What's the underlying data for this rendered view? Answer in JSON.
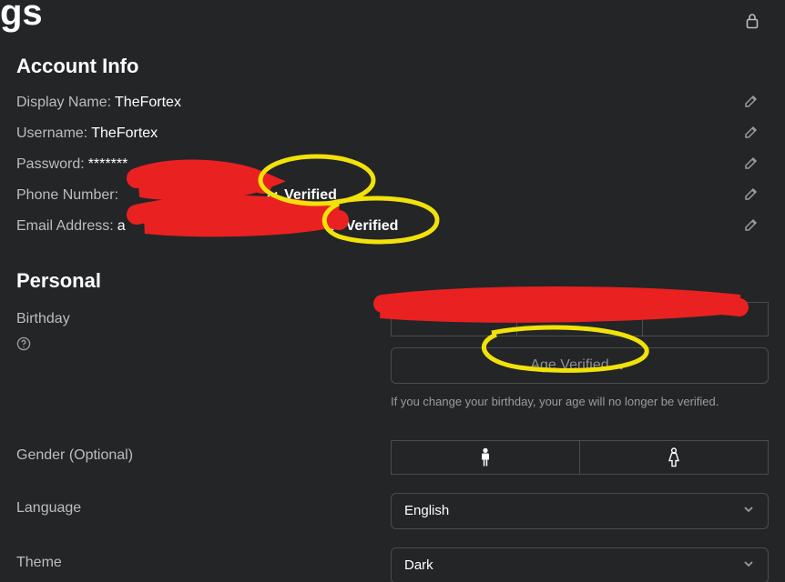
{
  "page_title_fragment": "gs",
  "sections": {
    "account_info": "Account Info",
    "personal": "Personal"
  },
  "account": {
    "display_name_label": "Display Name:",
    "display_name_value": "TheFortex",
    "username_label": "Username:",
    "username_value": "TheFortex",
    "password_label": "Password:",
    "password_value": "*******",
    "phone_label": "Phone Number:",
    "phone_verified": "Verified",
    "email_label": "Email Address:",
    "email_value_visible_prefix": "a",
    "email_verified": "Verified"
  },
  "personal": {
    "birthday_label": "Birthday",
    "age_verified": "Age Verified",
    "birthday_hint": "If you change your birthday, your age will no longer be verified.",
    "gender_label": "Gender (Optional)",
    "language_label": "Language",
    "language_value": "English",
    "theme_label": "Theme",
    "theme_value": "Dark"
  },
  "icons": {
    "lock": "lock-icon",
    "edit": "edit-icon",
    "check": "check-icon",
    "help": "help-icon",
    "male": "male-icon",
    "female": "female-icon",
    "chevron_down": "chevron-down-icon"
  },
  "colors": {
    "bg": "#232527",
    "border": "#4a4c4e",
    "muted": "#bdbdbd",
    "redaction": "#ea2121",
    "highlight": "#f2e20a"
  }
}
